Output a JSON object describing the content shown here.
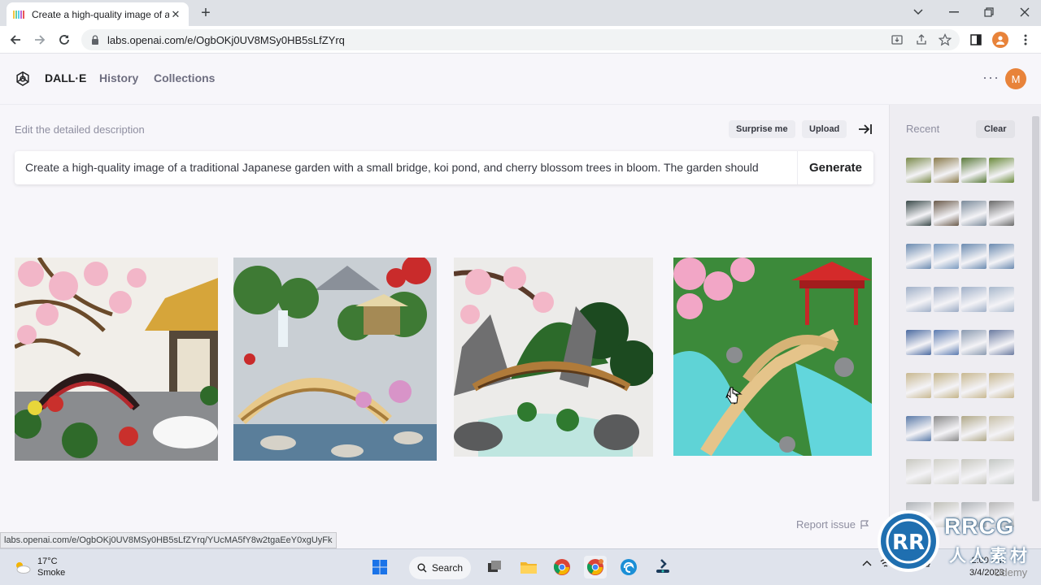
{
  "browser": {
    "tab_title": "Create a high-quality image of a",
    "url": "labs.openai.com/e/OgbOKj0UV8MSy0HB5sLfZYrq",
    "status_url": "labs.openai.com/e/OgbOKj0UV8MSy0HB5sLfZYrq/YUcMA5fY8w2tgaEeY0xgUyFk"
  },
  "header": {
    "brand": "DALL·E",
    "nav": [
      "History",
      "Collections"
    ],
    "avatar_initial": "M"
  },
  "editor": {
    "label": "Edit the detailed description",
    "surprise_label": "Surprise me",
    "upload_label": "Upload",
    "prompt_text": "Create a high-quality image of a traditional Japanese garden with a small bridge, koi pond, and cherry blossom trees in bloom. The garden should",
    "generate_label": "Generate"
  },
  "results": {
    "images": [
      "japanese-garden-1",
      "japanese-garden-2",
      "japanese-garden-3",
      "japanese-garden-4"
    ],
    "report_label": "Report issue"
  },
  "sidebar": {
    "recent_label": "Recent",
    "clear_label": "Clear",
    "thumb_rows": [
      [
        "#7a8a4a",
        "#8a7a4a",
        "#5a7a3a",
        "#6a8a3a"
      ],
      [
        "#3a4a4a",
        "#6a5a4a",
        "#7a8a9a",
        "#6a6a6a"
      ],
      [
        "#6a8ab0",
        "#7a9ac0",
        "#6a8ab0",
        "#6a8ab0"
      ],
      [
        "#a0b0c8",
        "#9aaac4",
        "#a0b0c8",
        "#a8b8cc"
      ],
      [
        "#4a6aa0",
        "#5a7ab0",
        "#8a9ab0",
        "#6a7aa0"
      ],
      [
        "#c8b890",
        "#c4b488",
        "#c8b890",
        "#c8b890"
      ],
      [
        "#5a7aa8",
        "#8a8a8a",
        "#b0a888",
        "#c8c0a8"
      ],
      [
        "#c8c8c0",
        "#d0d0c8",
        "#c8c8c0",
        "#c4c8c4"
      ],
      [
        "#b0b4b8",
        "#c0c0b8",
        "#b0b4b8",
        "#b8b8b8"
      ]
    ]
  },
  "taskbar": {
    "temperature": "17°C",
    "weather": "Smoke",
    "search_label": "Search",
    "time": "2:00 AM",
    "date": "3/4/2023"
  },
  "watermark": {
    "brand": "RRCG",
    "cn": "人人素材",
    "udemy": "Udemy"
  }
}
